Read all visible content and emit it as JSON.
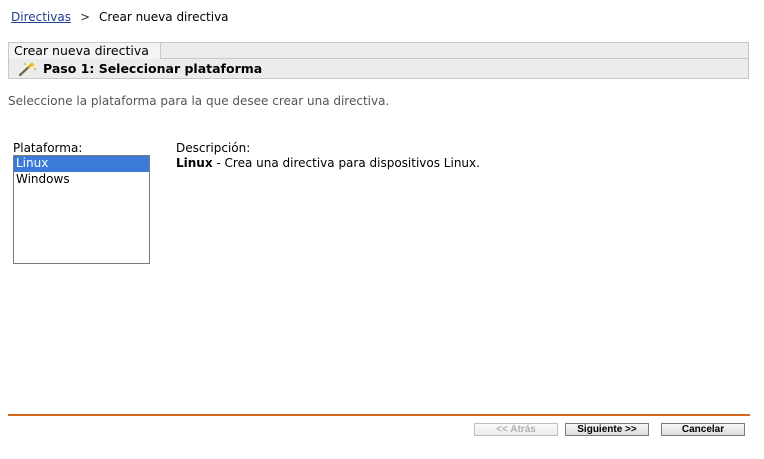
{
  "breadcrumb": {
    "parent": "Directivas",
    "separator": ">",
    "current": "Crear nueva directiva"
  },
  "wizard": {
    "tab_label": "Crear nueva directiva",
    "step_title": "Paso 1: Seleccionar plataforma",
    "step_icon": "wand-icon"
  },
  "instructions": "Seleccione la plataforma para la que desee crear una directiva.",
  "platform": {
    "label": "Plataforma:",
    "options": [
      "Linux",
      "Windows"
    ],
    "selected": "Linux"
  },
  "description": {
    "label": "Descripción:",
    "os_name": "Linux",
    "text": " - Crea una directiva para dispositivos Linux."
  },
  "buttons": {
    "back": "<< Atrás",
    "next": "Siguiente >>",
    "cancel": "Cancelar"
  },
  "colors": {
    "divider": "#d2691e",
    "selection": "#3a7ad8",
    "link": "#1f3f8f"
  }
}
